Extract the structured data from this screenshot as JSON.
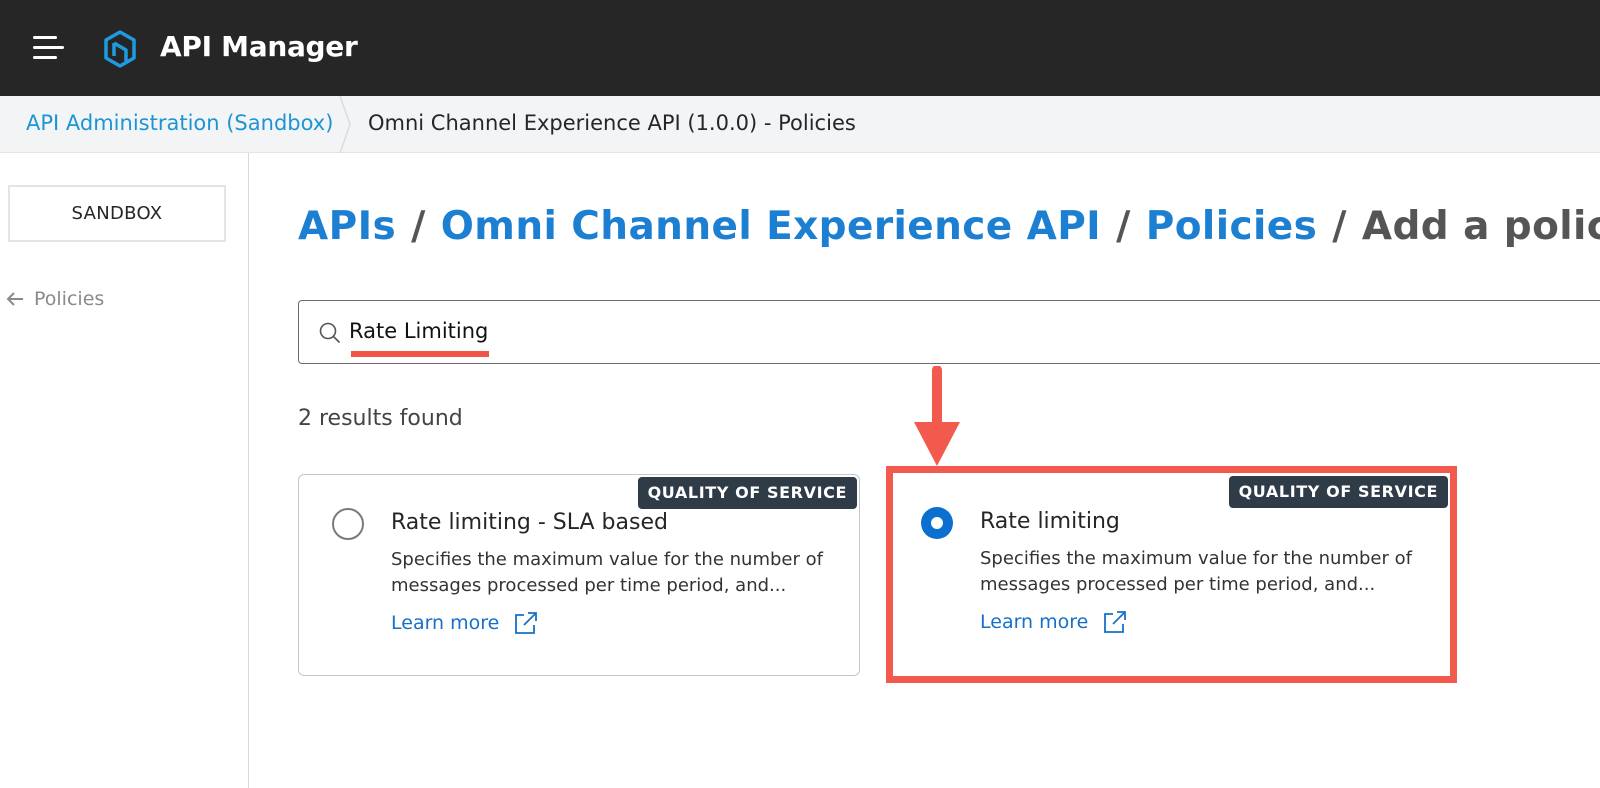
{
  "header": {
    "app_title": "API Manager",
    "menu_icon": "hamburger-menu-icon",
    "logo_icon": "api-manager-logo-icon"
  },
  "breadcrumb_bar": {
    "root_label": "API Administration (Sandbox)",
    "current_label": "Omni Channel Experience API (1.0.0) - Policies"
  },
  "sidebar": {
    "environment_label": "SANDBOX",
    "back_label": "Policies",
    "back_icon": "arrow-left-icon"
  },
  "page_heading": {
    "parts": [
      "APIs",
      "Omni Channel Experience API",
      "Policies"
    ],
    "current": "Add a policy",
    "separator": "/"
  },
  "search": {
    "value": "Rate Limiting",
    "icon": "search-icon"
  },
  "results": {
    "count_text": "2 results found",
    "cards": [
      {
        "badge": "QUALITY OF SERVICE",
        "title": "Rate limiting - SLA based",
        "description": "Specifies the maximum value for the number of messages processed per time period, and...",
        "learn_more": "Learn more",
        "selected": false
      },
      {
        "badge": "QUALITY OF SERVICE",
        "title": "Rate limiting",
        "description": "Specifies the maximum value for the number of messages processed per time period, and...",
        "learn_more": "Learn more",
        "selected": true
      }
    ]
  },
  "annotation": {
    "highlight_color": "#f25a4e",
    "arrow_icon": "arrow-down-icon"
  },
  "colors": {
    "topbar": "#262626",
    "link": "#1d7fd1",
    "radio_selected": "#0b6fd0",
    "badge": "#2f3b47"
  }
}
